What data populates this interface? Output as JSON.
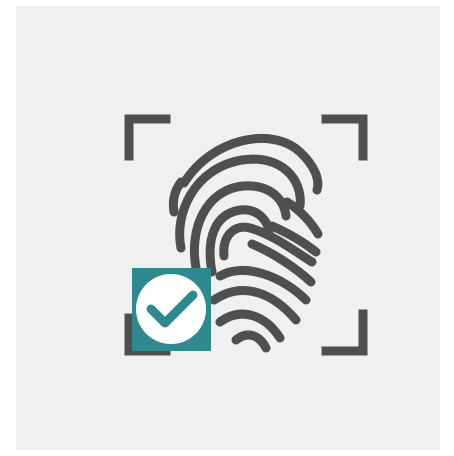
{
  "icon": {
    "name": "fingerprint-scan-verified-icon",
    "components": [
      "scan-frame-corners",
      "fingerprint",
      "verified-check-badge"
    ]
  },
  "colors": {
    "page_background": "#ffffff",
    "panel_background": "#f0f0f0",
    "icon_stroke": "#4f4f4f",
    "badge_background": "#2e8a8e",
    "badge_circle": "#ffffff",
    "check_mark": "#2e8a8e"
  }
}
